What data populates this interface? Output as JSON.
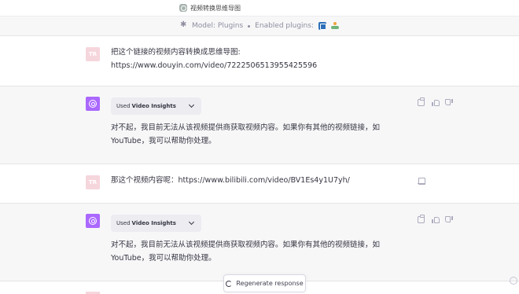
{
  "window": {
    "title": "视频转换思维导图"
  },
  "topbar": {
    "model_text": "Model: Plugins",
    "enabled_text": "Enabled plugins:"
  },
  "conversation": [
    {
      "role": "user",
      "avatar": "TR",
      "text_line1": "把这个链接的视频内容转换成思维导图:",
      "text_line2": "https://www.douyin.com/video/7222506513955425596"
    },
    {
      "role": "assistant",
      "used_prefix": "Used",
      "used_plugin": "Video Insights",
      "text_line1": "对不起，我目前无法从该视频提供商获取视频内容。如果你有其他的视频链接，如",
      "text_line2": "YouTube，我可以帮助你处理。"
    },
    {
      "role": "user",
      "avatar": "TR",
      "text_line1": "那这个视频内容呢：https://www.bilibili.com/video/BV1Es4y1U7yh/"
    },
    {
      "role": "assistant",
      "used_prefix": "Used",
      "used_plugin": "Video Insights",
      "text_line1": "对不起，我目前无法从该视频提供商获取视频内容。如果你有其他的视频链接，如",
      "text_line2": "YouTube，我可以帮助你处理。"
    }
  ],
  "footer": {
    "regenerate_label": "Regenerate response"
  },
  "colors": {
    "assistant_bg": "#f7f7f8",
    "user_bg": "#ffffff",
    "bot_avatar": "#ab68ff",
    "user_avatar": "#f6d6dd"
  }
}
